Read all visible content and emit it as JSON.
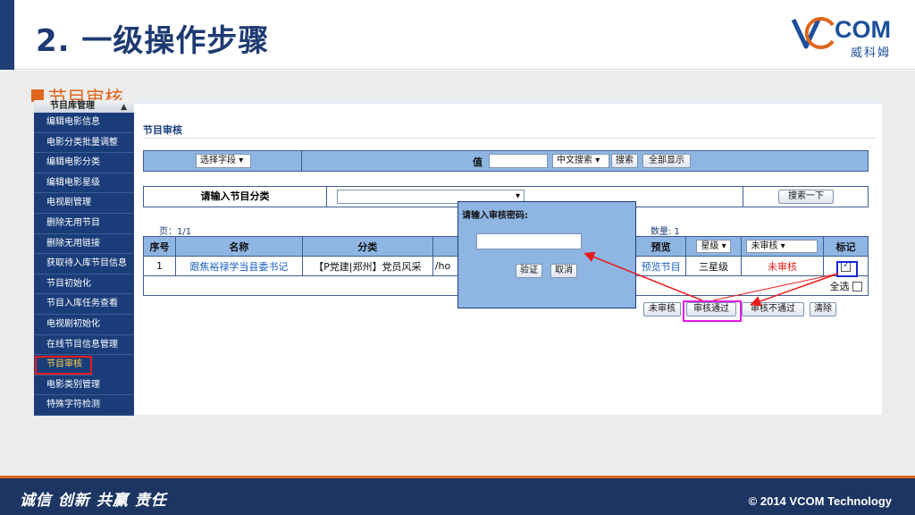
{
  "slide": {
    "title": "2. 一级操作步骤",
    "bullet": "节目审核",
    "logo_word": "COM",
    "logo_cn": "威科姆",
    "footer_slogan": "诚信 创新 共赢  责任",
    "footer_copyright": "© 2014 VCOM Technology"
  },
  "sidebar": {
    "header": "节目库管理",
    "caret": "▲",
    "items": [
      "编辑电影信息",
      "电影分类批量调整",
      "编辑电影分类",
      "编辑电影星级",
      "电视剧管理",
      "删除无用节目",
      "删除无用链接",
      "获取待入库节目信息",
      "节目初始化",
      "节目入库任务查看",
      "电视剧初始化",
      "在线节目信息管理",
      "节目审核",
      "电影类别管理",
      "特殊字符检测"
    ]
  },
  "page": {
    "heading": "节目审核",
    "field_select": "选择字段",
    "value_label": "值",
    "search_mode": "中文搜索",
    "search_button": "搜索",
    "show_all_button": "全部显示",
    "category_label": "请输入节目分类",
    "search_next_button": "搜索一下",
    "pager": "页：1/1",
    "count": "数量: 1"
  },
  "table": {
    "headers": {
      "no": "序号",
      "name": "名称",
      "category": "分类",
      "path": "",
      "preview": "预览",
      "star": "星级",
      "review": "未审核",
      "mark": "标记"
    },
    "rows": [
      {
        "no": "1",
        "name": "跟焦裕禄学当县委书记",
        "category": "【P党建|郑州】党员风采",
        "path": "/ho",
        "preview": "预览节目",
        "star": "三星级",
        "review": "未审核"
      }
    ],
    "select_all": "全选"
  },
  "actions": {
    "unreviewed": "未审核",
    "pass": "审核通过",
    "reject": "审核不通过",
    "clear": "清除"
  },
  "dialog": {
    "title": "请输入审核密码:",
    "verify": "验证",
    "cancel": "取消"
  },
  "colors": {
    "brand_navy": "#1c3563",
    "title_blue": "#1e3a72",
    "accent_orange": "#e0661e",
    "grid_blue": "#8fb6e3",
    "alert_red": "#e81b1b",
    "highlight_magenta": "#e31ae3",
    "highlight_blue": "#1428d8"
  }
}
